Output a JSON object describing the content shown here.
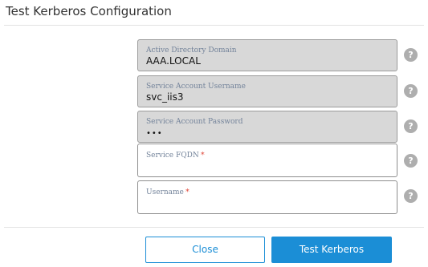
{
  "dialog": {
    "title": "Test Kerberos Configuration"
  },
  "fields": [
    {
      "label": "Active Directory Domain",
      "value": "AAA.LOCAL",
      "disabled": true,
      "required": false
    },
    {
      "label": "Service Account Username",
      "value": "svc_iis3",
      "disabled": true,
      "required": false
    },
    {
      "label": "Service Account Password",
      "value": "•••",
      "disabled": true,
      "required": false
    },
    {
      "label": "Service FQDN",
      "value": "",
      "disabled": false,
      "required": true
    },
    {
      "label": "Username",
      "value": "",
      "disabled": false,
      "required": true
    }
  ],
  "required_marker": "*",
  "help_glyph": "?",
  "help_icon_name": "question-circle-icon",
  "buttons": {
    "close_label": "Close",
    "test_label": "Test Kerberos"
  },
  "colors": {
    "accent": "#1b8ed6",
    "required": "#e0483a",
    "disabled_field_bg": "#d8d8d8",
    "help_icon_bg": "#aeaeae"
  }
}
